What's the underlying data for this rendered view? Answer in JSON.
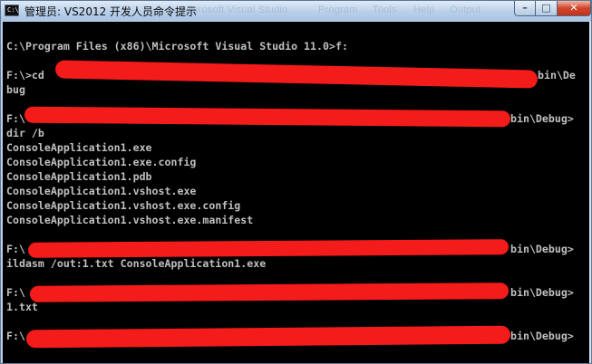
{
  "window": {
    "title": "管理员: VS2012 开发人员命令提示",
    "icon_name": "console-icon",
    "background_tab_text": [
      "Microsoft Visual Studio",
      "Program",
      "Tools",
      "Help",
      "Output"
    ],
    "buttons": {
      "minimize_icon": "minimize-icon",
      "maximize_icon": "maximize-icon",
      "close_icon": "close-icon"
    }
  },
  "console": {
    "colors": {
      "background": "#000000",
      "text": "#c0c0c0",
      "redaction": "#f41b1b"
    },
    "lines": [
      "C:\\Program Files (x86)\\Microsoft Visual Studio 11.0>f:",
      "F:\\>cd",
      "bin\\De",
      "bug",
      "F:\\",
      "bin\\Debug>",
      "dir /b",
      "ConsoleApplication1.exe",
      "ConsoleApplication1.exe.config",
      "ConsoleApplication1.pdb",
      "ConsoleApplication1.vshost.exe",
      "ConsoleApplication1.vshost.exe.config",
      "ConsoleApplication1.vshost.exe.manifest",
      "F:\\",
      "bin\\Debug>",
      "ildasm /out:1.txt ConsoleApplication1.exe",
      "F:\\",
      "bin\\Debug>",
      "1.txt",
      "F:\\",
      "bin\\Debug>"
    ]
  }
}
